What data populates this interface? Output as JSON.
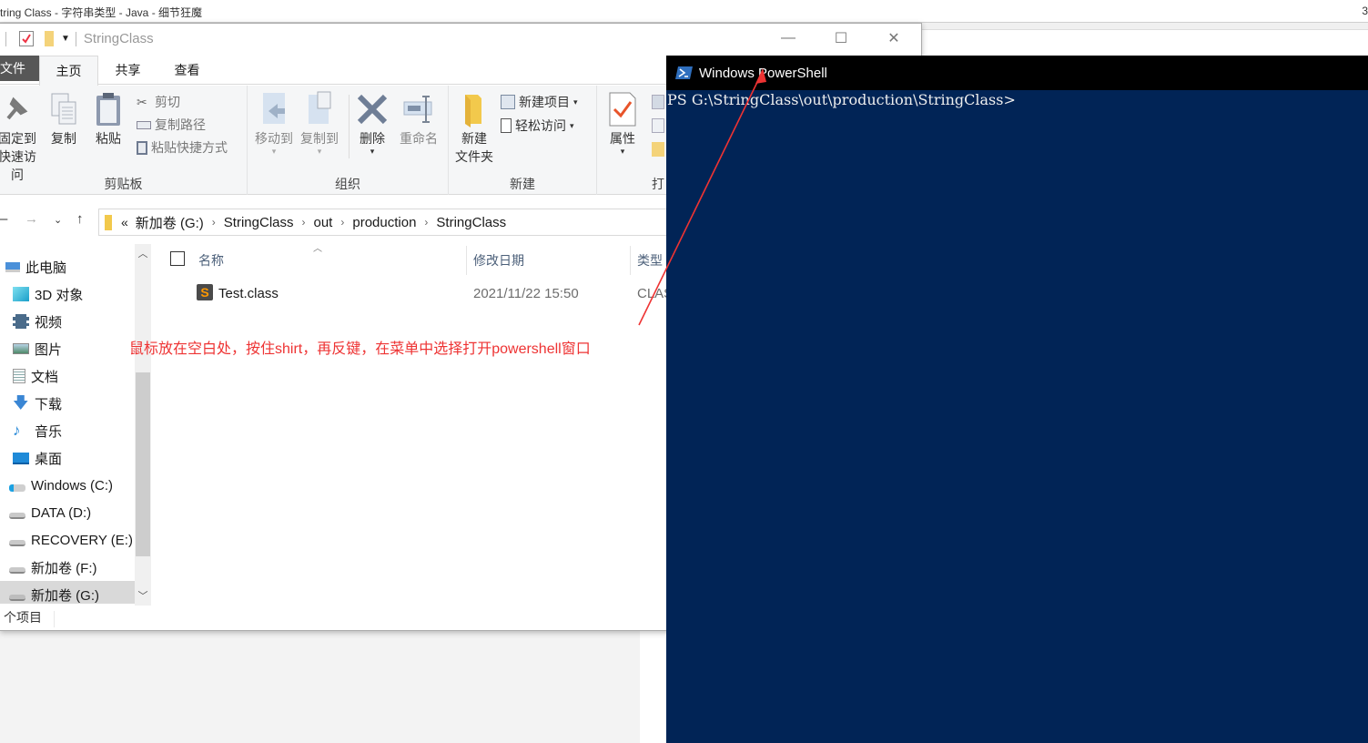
{
  "background_window": {
    "title": "tring Class - 字符串类型 - Java - 细节狂魔",
    "corner_text": "3"
  },
  "explorer": {
    "quick_access_title": "StringClass",
    "window_controls": {
      "minimize": "—",
      "maximize": "☐",
      "close": "✕"
    },
    "tabs": [
      {
        "label": "文件",
        "active": false
      },
      {
        "label": "主页",
        "active": true
      },
      {
        "label": "共享",
        "active": false
      },
      {
        "label": "查看",
        "active": false
      }
    ],
    "ribbon": {
      "clipboard": {
        "label": "剪贴板",
        "pin": "固定到快速访问",
        "pin_line1": "固定到",
        "pin_line2": "快速访问",
        "copy": "复制",
        "paste": "粘贴",
        "cut": "剪切",
        "copy_path": "复制路径",
        "paste_shortcut": "粘贴快捷方式"
      },
      "organize": {
        "label": "组织",
        "move_to": "移动到",
        "copy_to": "复制到",
        "delete": "删除",
        "rename": "重命名"
      },
      "new": {
        "label": "新建",
        "new_folder_line1": "新建",
        "new_folder_line2": "文件夹",
        "new_item": "新建项目",
        "easy_access": "轻松访问"
      },
      "open": {
        "label": "打开",
        "label_partial": "打",
        "properties": "属性"
      }
    },
    "address_bar": {
      "overflow": "«",
      "crumbs": [
        "新加卷 (G:)",
        "StringClass",
        "out",
        "production",
        "StringClass"
      ]
    },
    "nav_pane": {
      "items": [
        {
          "label": "此电脑",
          "icon": "computer-icon",
          "selected": false
        },
        {
          "label": "3D 对象",
          "icon": "3d-objects-icon",
          "selected": false
        },
        {
          "label": "视频",
          "icon": "video-icon",
          "selected": false
        },
        {
          "label": "图片",
          "icon": "pictures-icon",
          "selected": false
        },
        {
          "label": "文档",
          "icon": "documents-icon",
          "selected": false
        },
        {
          "label": "下载",
          "icon": "download-icon",
          "selected": false
        },
        {
          "label": "音乐",
          "icon": "music-icon",
          "selected": false
        },
        {
          "label": "桌面",
          "icon": "desktop-icon",
          "selected": false
        },
        {
          "label": "Windows (C:)",
          "icon": "windows-drive-icon",
          "selected": false
        },
        {
          "label": "DATA (D:)",
          "icon": "drive-icon",
          "selected": false
        },
        {
          "label": "RECOVERY (E:)",
          "icon": "drive-icon",
          "selected": false
        },
        {
          "label": "新加卷 (F:)",
          "icon": "drive-icon",
          "selected": false
        },
        {
          "label": "新加卷 (G:)",
          "icon": "drive-icon",
          "selected": true
        }
      ]
    },
    "file_list": {
      "columns": [
        "名称",
        "修改日期",
        "类型"
      ],
      "rows": [
        {
          "name": "Test.class",
          "modified": "2021/11/22 15:50",
          "type": "CLAS"
        }
      ]
    },
    "status_bar": {
      "text": "个项目"
    }
  },
  "annotation": {
    "text": "鼠标放在空白处，按住shirt，再反键，在菜单中选择打开powershell窗口",
    "color": "#ee3333"
  },
  "powershell": {
    "title": "Windows PowerShell",
    "prompt": "PS G:\\StringClass\\out\\production\\StringClass>",
    "background": "#012456"
  }
}
